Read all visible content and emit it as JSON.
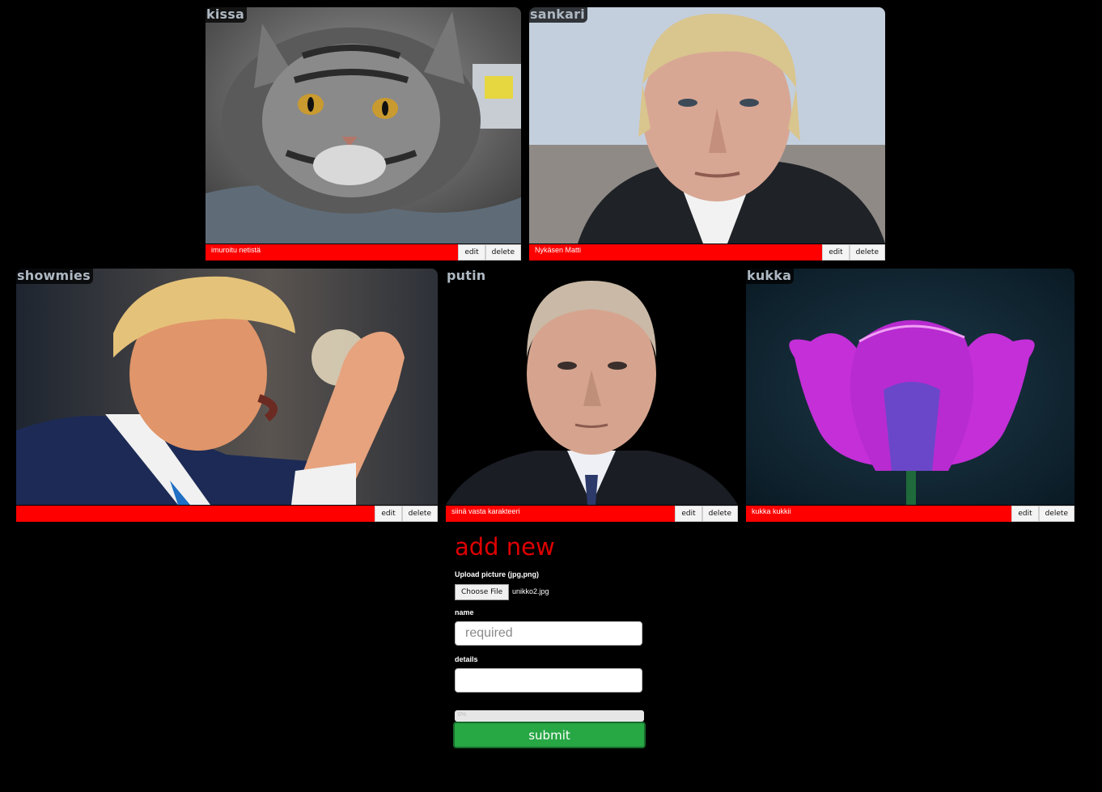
{
  "cards": [
    {
      "title": "kissa",
      "details": "imuroitu netistä",
      "edit": "edit",
      "delete": "delete",
      "image": "tabby-cat-photo"
    },
    {
      "title": "sankari",
      "details": "Nykäsen Matti",
      "edit": "edit",
      "delete": "delete",
      "image": "portrait-photo"
    },
    {
      "title": "showmies",
      "details": "",
      "edit": "edit",
      "delete": "delete",
      "image": "speaker-photo"
    },
    {
      "title": "putin",
      "details": "siinä vasta karakteeri",
      "edit": "edit",
      "delete": "delete",
      "image": "portrait-photo"
    },
    {
      "title": "kukka",
      "details": "kukka kukkii",
      "edit": "edit",
      "delete": "delete",
      "image": "purple-tulip-photo"
    }
  ],
  "form": {
    "heading": "add new",
    "upload_label": "Upload picture (jpg,png)",
    "choose_file": "Choose File",
    "file_name": "unikko2.jpg",
    "name_label": "name",
    "name_placeholder": "required",
    "details_label": "details",
    "details_value": "",
    "progress_text": "0%",
    "progress_fraction": 0.0,
    "submit": "submit"
  },
  "colors": {
    "background": "#000000",
    "accent_red": "#ff0000",
    "heading_red": "#e00000",
    "submit_green": "#28a745"
  }
}
